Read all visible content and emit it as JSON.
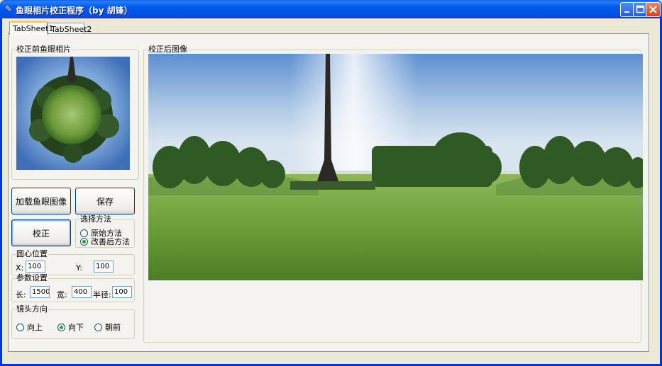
{
  "window": {
    "title": "鱼眼相片校正程序（by 胡锋）",
    "app_icon": "app-icon"
  },
  "tabs": [
    {
      "label": "TabSheet1",
      "active": true
    },
    {
      "label": "TabSheet2",
      "active": false
    }
  ],
  "before_group": {
    "label": "校正前鱼眼相片"
  },
  "after_group": {
    "label": "校正后图像"
  },
  "buttons": {
    "load": "加载鱼眼图像",
    "save": "保存",
    "correct": "校正"
  },
  "method": {
    "label": "选择方法",
    "options": [
      {
        "label": "原始方法",
        "checked": false
      },
      {
        "label": "改善后方法",
        "checked": true
      }
    ]
  },
  "center": {
    "label": "圆心位置",
    "x_label": "X:",
    "x_value": "100",
    "y_label": "Y:",
    "y_value": "100"
  },
  "params": {
    "label": "参数设置",
    "length_label": "长:",
    "length_value": "1500",
    "width_label": "宽:",
    "width_value": "400",
    "radius_label": "半径:",
    "radius_value": "100"
  },
  "lens": {
    "label": "镜头方向",
    "options": [
      {
        "label": "向上",
        "checked": false
      },
      {
        "label": "向下",
        "checked": true
      },
      {
        "label": "朝前",
        "checked": false
      }
    ]
  },
  "colors": {
    "titlebar": "#0058ee",
    "dialog": "#ece9d8",
    "sky": "#6f9ed8",
    "grass": "#5f9a2e"
  }
}
